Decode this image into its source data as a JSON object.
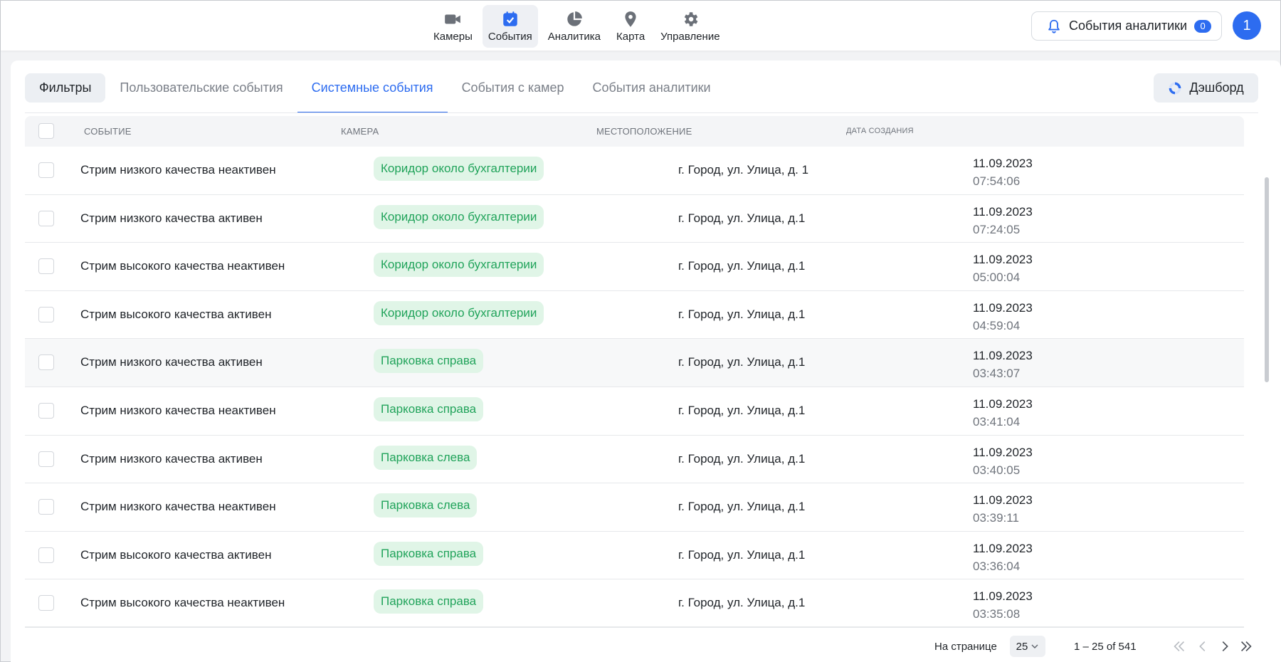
{
  "nav": {
    "items": [
      {
        "label": "Камеры",
        "icon": "video-camera-icon"
      },
      {
        "label": "События",
        "icon": "calendar-check-icon",
        "active": true
      },
      {
        "label": "Аналитика",
        "icon": "pie-chart-icon"
      },
      {
        "label": "Карта",
        "icon": "map-pin-icon"
      },
      {
        "label": "Управление",
        "icon": "gear-icon"
      }
    ]
  },
  "header": {
    "notifications_label": "События аналитики",
    "notifications_count": "0",
    "avatar_initial": "1"
  },
  "tabs": {
    "filters_label": "Фильтры",
    "items": [
      {
        "label": "Пользовательские события"
      },
      {
        "label": "Системные события",
        "active": true
      },
      {
        "label": "События с камер"
      },
      {
        "label": "События аналитики"
      }
    ],
    "dashboard_label": "Дэшборд"
  },
  "table": {
    "columns": [
      "СОБЫТИЕ",
      "КАМЕРА",
      "МЕСТОПОЛОЖЕНИЕ",
      "ДАТА СОЗДАНИЯ"
    ],
    "rows": [
      {
        "event": "Стрим низкого качества неактивен",
        "camera": "Коридор около бухгалтерии",
        "location": "г. Город, ул. Улица, д. 1",
        "date": "11.09.2023",
        "time": "07:54:06"
      },
      {
        "event": "Стрим низкого качества активен",
        "camera": "Коридор около бухгалтерии",
        "location": "г. Город, ул. Улица, д.1",
        "date": "11.09.2023",
        "time": "07:24:05"
      },
      {
        "event": "Стрим высокого качества неактивен",
        "camera": "Коридор около бухгалтерии",
        "location": "г. Город, ул. Улица, д.1",
        "date": "11.09.2023",
        "time": "05:00:04"
      },
      {
        "event": "Стрим высокого качества активен",
        "camera": "Коридор около бухгалтерии",
        "location": "г. Город, ул. Улица, д.1",
        "date": "11.09.2023",
        "time": "04:59:04"
      },
      {
        "event": "Стрим низкого качества активен",
        "camera": "Парковка справа",
        "location": "г. Город, ул. Улица, д.1",
        "date": "11.09.2023",
        "time": "03:43:07"
      },
      {
        "event": "Стрим низкого качества неактивен",
        "camera": "Парковка справа",
        "location": "г. Город, ул. Улица, д.1",
        "date": "11.09.2023",
        "time": "03:41:04"
      },
      {
        "event": "Стрим низкого качества активен",
        "camera": "Парковка слева",
        "location": "г. Город, ул. Улица, д.1",
        "date": "11.09.2023",
        "time": "03:40:05"
      },
      {
        "event": "Стрим низкого качества неактивен",
        "camera": "Парковка слева",
        "location": "г. Город, ул. Улица, д.1",
        "date": "11.09.2023",
        "time": "03:39:11"
      },
      {
        "event": "Стрим высокого качества активен",
        "camera": "Парковка справа",
        "location": "г. Город, ул. Улица, д.1",
        "date": "11.09.2023",
        "time": "03:36:04"
      },
      {
        "event": "Стрим высокого качества неактивен",
        "camera": "Парковка справа",
        "location": "г. Город, ул. Улица, д.1",
        "date": "11.09.2023",
        "time": "03:35:08"
      }
    ]
  },
  "pagination": {
    "per_page_label": "На странице",
    "per_page_value": "25",
    "range": "1 – 25 of 541"
  },
  "colors": {
    "accent": "#2d6cf0",
    "chip_bg": "#e0f5e7",
    "chip_text": "#20a35a"
  }
}
